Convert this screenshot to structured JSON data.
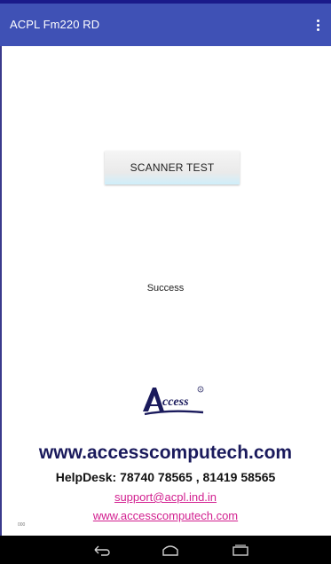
{
  "app_bar": {
    "title": "ACPL Fm220 RD",
    "menu_icon": "more-vert-icon"
  },
  "main": {
    "scanner_button_label": "SCANNER TEST",
    "status_text": "Success"
  },
  "branding": {
    "logo_text": "Access",
    "website_headline": "www.accesscomputech.com",
    "helpdesk": "HelpDesk: 78740 78565 , 81419 58565",
    "support_email": "support@acpl.ind.in",
    "website_link": "www.accesscomputech.com",
    "footnote": "000"
  },
  "nav": {
    "back_icon": "back-icon",
    "home_icon": "home-icon",
    "recents_icon": "recents-icon"
  },
  "colors": {
    "app_bar": "#3f51b5",
    "headline": "#1a1a5c",
    "link": "#d21f8f",
    "nav_bar": "#000000"
  }
}
